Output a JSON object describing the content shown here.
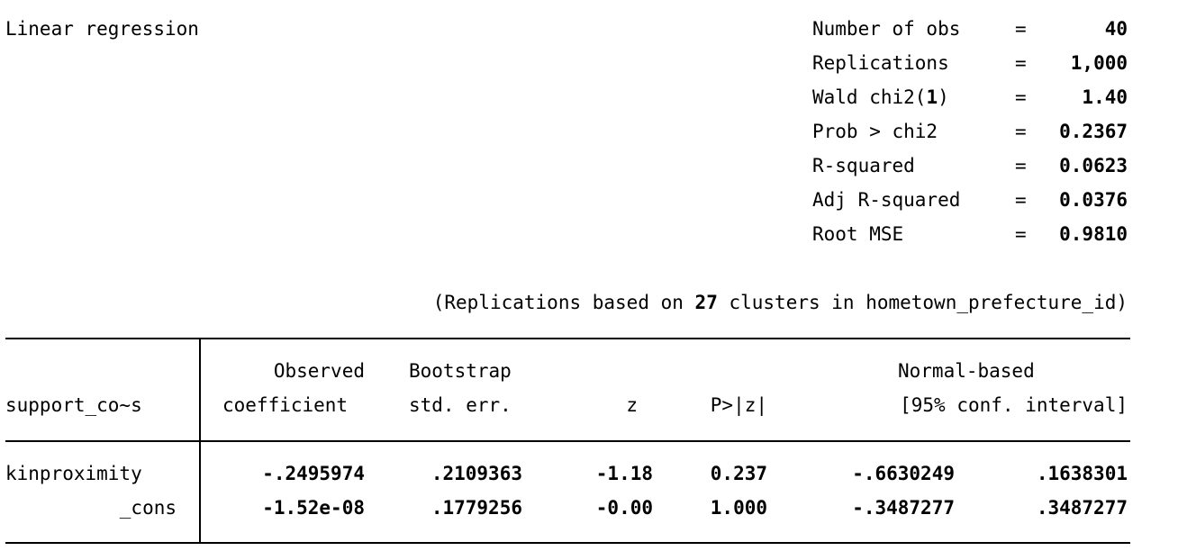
{
  "title": "Linear regression",
  "stats": [
    {
      "label": "Number of obs",
      "eq": "=",
      "value": "40"
    },
    {
      "label": "Replications",
      "eq": "=",
      "value": "1,000"
    },
    {
      "label": "Wald chi2(",
      "label_bold": "1",
      "label_end": ")",
      "eq": "=",
      "value": "1.40"
    },
    {
      "label": "Prob > chi2",
      "eq": "=",
      "value": "0.2367"
    },
    {
      "label": "R-squared",
      "eq": "=",
      "value": "0.0623"
    },
    {
      "label": "Adj R-squared",
      "eq": "=",
      "value": "0.0376"
    },
    {
      "label": "Root MSE",
      "eq": "=",
      "value": "0.9810"
    }
  ],
  "note": {
    "pre": "(Replications based on ",
    "bold": "27",
    "post": " clusters in hometown_prefecture_id)"
  },
  "table": {
    "header_row1": {
      "observed": "Observed",
      "bootstrap": "Bootstrap",
      "normal_based": "Normal-based"
    },
    "header_row2": {
      "depvar": "support_co~s",
      "coefficient": "coefficient",
      "std_err": "std. err.",
      "z": "z",
      "p": "P>|z|",
      "ci": "[95% conf. interval]"
    },
    "rows": [
      {
        "name": "kinproximity",
        "coef": "-.2495974",
        "se": ".2109363",
        "z": "-1.18",
        "p": "0.237",
        "ci_low": "-.6630249",
        "ci_high": ".1638301"
      },
      {
        "name": "_cons",
        "coef": "-1.52e-08",
        "se": ".1779256",
        "z": "-0.00",
        "p": "1.000",
        "ci_low": "-.3487277",
        "ci_high": ".3487277"
      }
    ]
  }
}
